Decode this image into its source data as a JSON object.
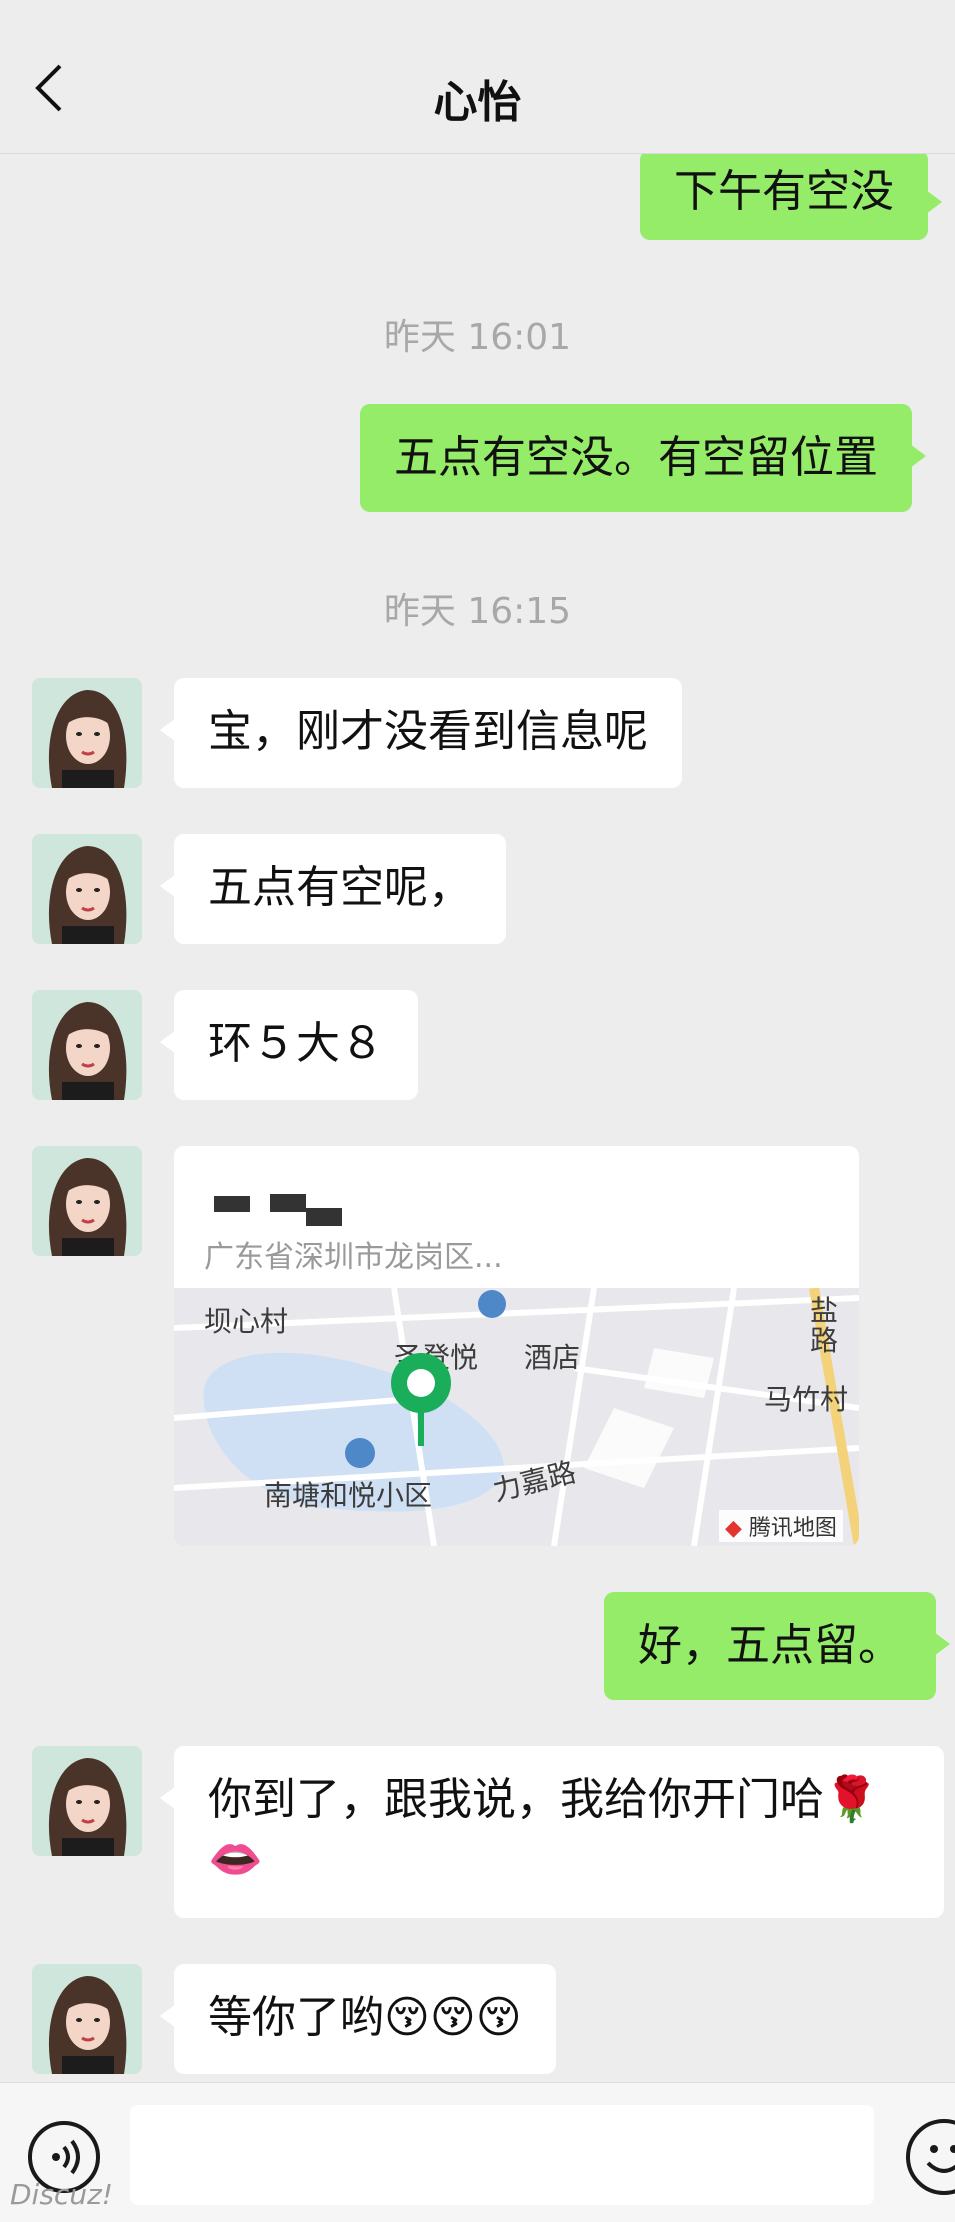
{
  "header": {
    "title": "心怡",
    "back_icon": "chevron-left-icon"
  },
  "messages": {
    "m1": "下午有空没",
    "t1": "昨天 16:01",
    "m2": "五点有空没。有空留位置",
    "t2": "昨天 16:15",
    "m3": "宝，刚才没看到信息呢",
    "m4": "五点有空呢，",
    "m5": "环５大８",
    "location": {
      "address": "广东省深圳市龙岗区...",
      "map_labels": {
        "l1": "坝心村",
        "l2": "圣登悦",
        "l3": "酒店",
        "l4": "南塘和悦小区",
        "l5": "力嘉路",
        "l6": "马竹村",
        "l7": "盐路",
        "provider": "腾讯地图"
      }
    },
    "m6": "好，五点留。",
    "m7_line1": "你到了，跟我说，我给你开门哈🌹",
    "m7_line2": "👄",
    "m8": "等你了哟😚😚😚"
  },
  "input": {
    "voice_icon": "voice-icon",
    "emoji_icon": "emoji-icon",
    "placeholder": ""
  },
  "watermark": "Discuz!",
  "colors": {
    "sent_bubble": "#95ec69",
    "received_bubble": "#ffffff",
    "background": "#ededed",
    "map_pin": "#1aad5a"
  }
}
